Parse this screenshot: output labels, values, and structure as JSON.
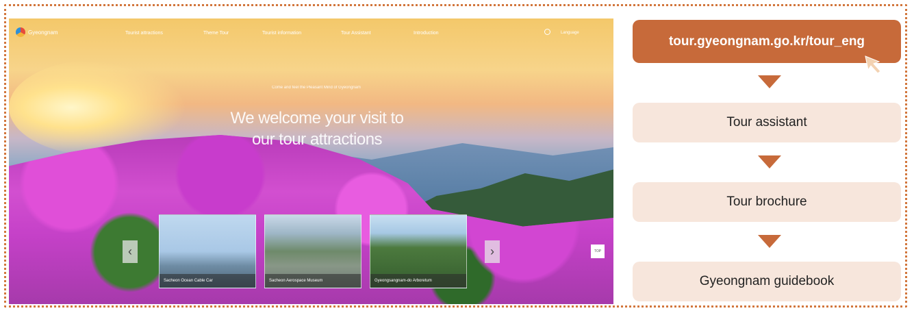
{
  "website": {
    "logo_text": "Gyeongnam",
    "nav_items": [
      "Tourist attractions",
      "Theme Tour",
      "Tourist information",
      "Tour Assistant",
      "Introduction"
    ],
    "language_label": "Language",
    "hero_subtitle": "Come and feel the Pleasant Mind of Gyeongnam",
    "hero_title": "We welcome your visit to our tour attractions",
    "cards": [
      {
        "caption": "Sacheon Ocean Cable Car"
      },
      {
        "caption": "Sacheon Aerospace Museum"
      },
      {
        "caption": "Gyeongsangnam-do Arboretum"
      }
    ],
    "prev_arrow": "‹",
    "next_arrow": "›",
    "top_button": "TOP"
  },
  "flow": {
    "url": "tour.gyeongnam.go.kr/tour_eng",
    "steps": [
      "Tour assistant",
      "Tour brochure",
      "Gyeongnam guidebook"
    ]
  },
  "colors": {
    "accent": "#c76a3a",
    "step_bg": "#f7e6dc",
    "border_dots": "#d2763c"
  }
}
